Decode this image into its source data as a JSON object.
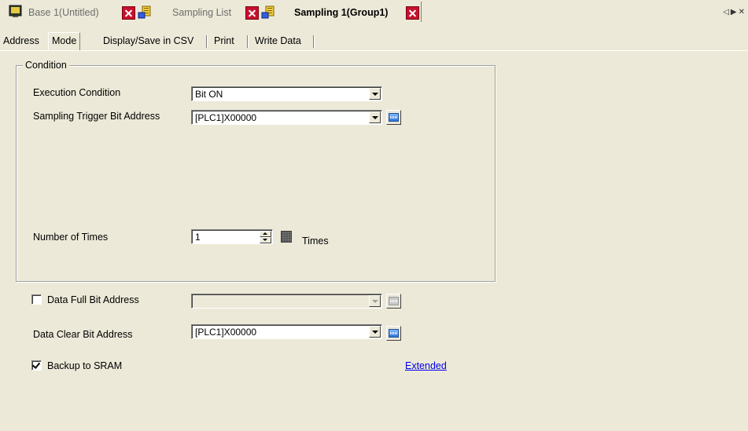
{
  "document_tabs": [
    {
      "label": "Base 1(Untitled)",
      "icon": "screen-icon",
      "active": false
    },
    {
      "label": "Sampling List",
      "icon": "list-icon",
      "active": false
    },
    {
      "label": "Sampling 1(Group1)",
      "icon": "list-icon",
      "active": true
    }
  ],
  "property_tabs": [
    "Address",
    "Mode",
    "Display/Save in CSV",
    "Print",
    "Write Data"
  ],
  "active_property_tab": "Mode",
  "condition": {
    "legend": "Condition",
    "execution_condition_label": "Execution Condition",
    "execution_condition_value": "Bit ON",
    "trigger_bit_label": "Sampling Trigger Bit Address",
    "trigger_bit_value": "[PLC1]X00000",
    "number_of_times_label": "Number of Times",
    "number_of_times_value": "1",
    "times_unit": "Times"
  },
  "data_full": {
    "label": "Data Full Bit Address",
    "checked": false,
    "value": ""
  },
  "data_clear": {
    "label": "Data Clear Bit Address",
    "value": "[PLC1]X00000"
  },
  "backup": {
    "label": "Backup to SRAM",
    "checked": true
  },
  "extended_link": "Extended",
  "colors": {
    "background": "#ece9d8",
    "close_red": "#c8102e",
    "link": "#0000ee"
  }
}
